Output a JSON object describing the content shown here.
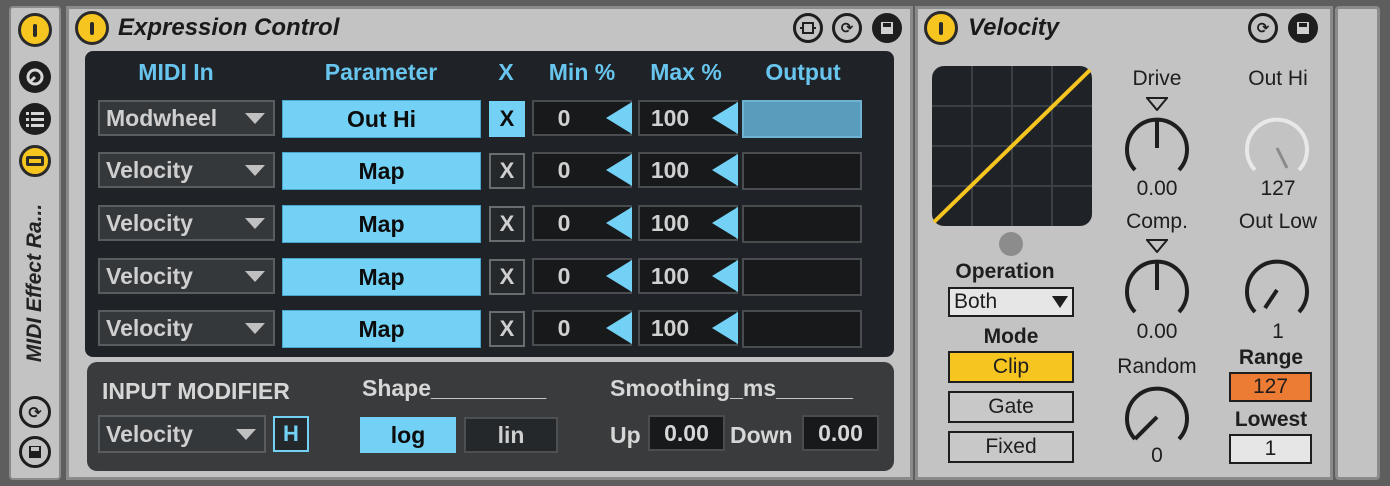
{
  "rack": {
    "title": "MIDI Effect Ra...",
    "icons": [
      "power-icon",
      "chain-icon",
      "list-icon",
      "macro-icon",
      "hot-swap-icon",
      "save-icon"
    ]
  },
  "expression": {
    "title": "Expression Control",
    "header_icons": [
      "map-icon",
      "hot-swap-icon",
      "save-icon"
    ],
    "columns": [
      "MIDI In",
      "Parameter",
      "X",
      "Min %",
      "Max %",
      "Output"
    ],
    "rows": [
      {
        "midi_in": "Modwheel",
        "parameter": "Out Hi",
        "x": "X",
        "min": "0",
        "max": "100",
        "active": true
      },
      {
        "midi_in": "Velocity",
        "parameter": "Map",
        "x": "X",
        "min": "0",
        "max": "100",
        "active": false
      },
      {
        "midi_in": "Velocity",
        "parameter": "Map",
        "x": "X",
        "min": "0",
        "max": "100",
        "active": false
      },
      {
        "midi_in": "Velocity",
        "parameter": "Map",
        "x": "X",
        "min": "0",
        "max": "100",
        "active": false
      },
      {
        "midi_in": "Velocity",
        "parameter": "Map",
        "x": "X",
        "min": "0",
        "max": "100",
        "active": false
      }
    ],
    "input_modifier": {
      "label": "INPUT MODIFIER",
      "source": "Velocity",
      "hold": "H",
      "shape_label": "Shape_________",
      "shape_options": [
        "log",
        "lin"
      ],
      "shape_selected": "log",
      "smoothing_label": "Smoothing_ms______",
      "up_label": "Up",
      "up_value": "0.00",
      "down_label": "Down",
      "down_value": "0.00"
    }
  },
  "velocity": {
    "title": "Velocity",
    "header_icons": [
      "hot-swap-icon",
      "save-icon"
    ],
    "curve_color": "#f7c51f",
    "drive": {
      "label": "Drive",
      "value": "0.00"
    },
    "comp": {
      "label": "Comp.",
      "value": "0.00"
    },
    "random": {
      "label": "Random",
      "value": "0"
    },
    "out_hi": {
      "label": "Out Hi",
      "value": "127"
    },
    "out_low": {
      "label": "Out Low",
      "value": "1"
    },
    "operation": {
      "label": "Operation",
      "selected": "Both"
    },
    "mode": {
      "label": "Mode",
      "options": [
        "Clip",
        "Gate",
        "Fixed"
      ],
      "selected": "Clip"
    },
    "range": {
      "label": "Range",
      "value": "127"
    },
    "lowest": {
      "label": "Lowest",
      "value": "1"
    }
  },
  "colors": {
    "accent_blue": "#74d1f6",
    "power_yellow": "#f7c51f",
    "range_orange": "#ec7b33",
    "panel_dark": "#1f2327"
  }
}
